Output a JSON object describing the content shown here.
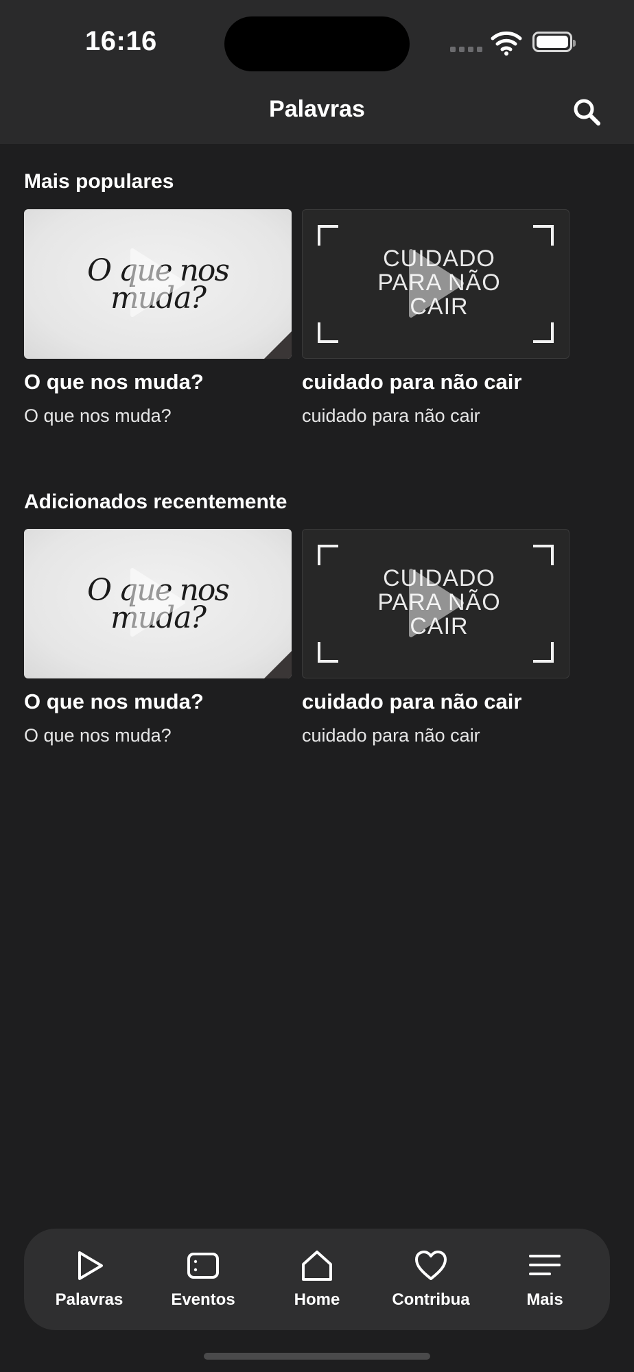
{
  "status_bar": {
    "time": "16:16"
  },
  "nav": {
    "title": "Palavras"
  },
  "sections": [
    {
      "title": "Mais populares",
      "cards": [
        {
          "title": "O que nos muda?",
          "subtitle": "O que nos muda?",
          "thumb_text": "O que nos muda?"
        },
        {
          "title": "cuidado para não cair",
          "subtitle": "cuidado para não cair",
          "thumb_text": "CUIDADO PARA NÃO CAIR"
        }
      ]
    },
    {
      "title": "Adicionados recentemente",
      "cards": [
        {
          "title": "O que nos muda?",
          "subtitle": "O que nos muda?",
          "thumb_text": "O que nos muda?"
        },
        {
          "title": "cuidado para não cair",
          "subtitle": "cuidado para não cair",
          "thumb_text": "CUIDADO PARA NÃO CAIR"
        }
      ]
    }
  ],
  "tabbar": {
    "items": [
      {
        "label": "Palavras",
        "icon": "play-icon"
      },
      {
        "label": "Eventos",
        "icon": "calendar-card-icon"
      },
      {
        "label": "Home",
        "icon": "home-icon"
      },
      {
        "label": "Contribua",
        "icon": "heart-icon"
      },
      {
        "label": "Mais",
        "icon": "menu-icon"
      }
    ]
  }
}
